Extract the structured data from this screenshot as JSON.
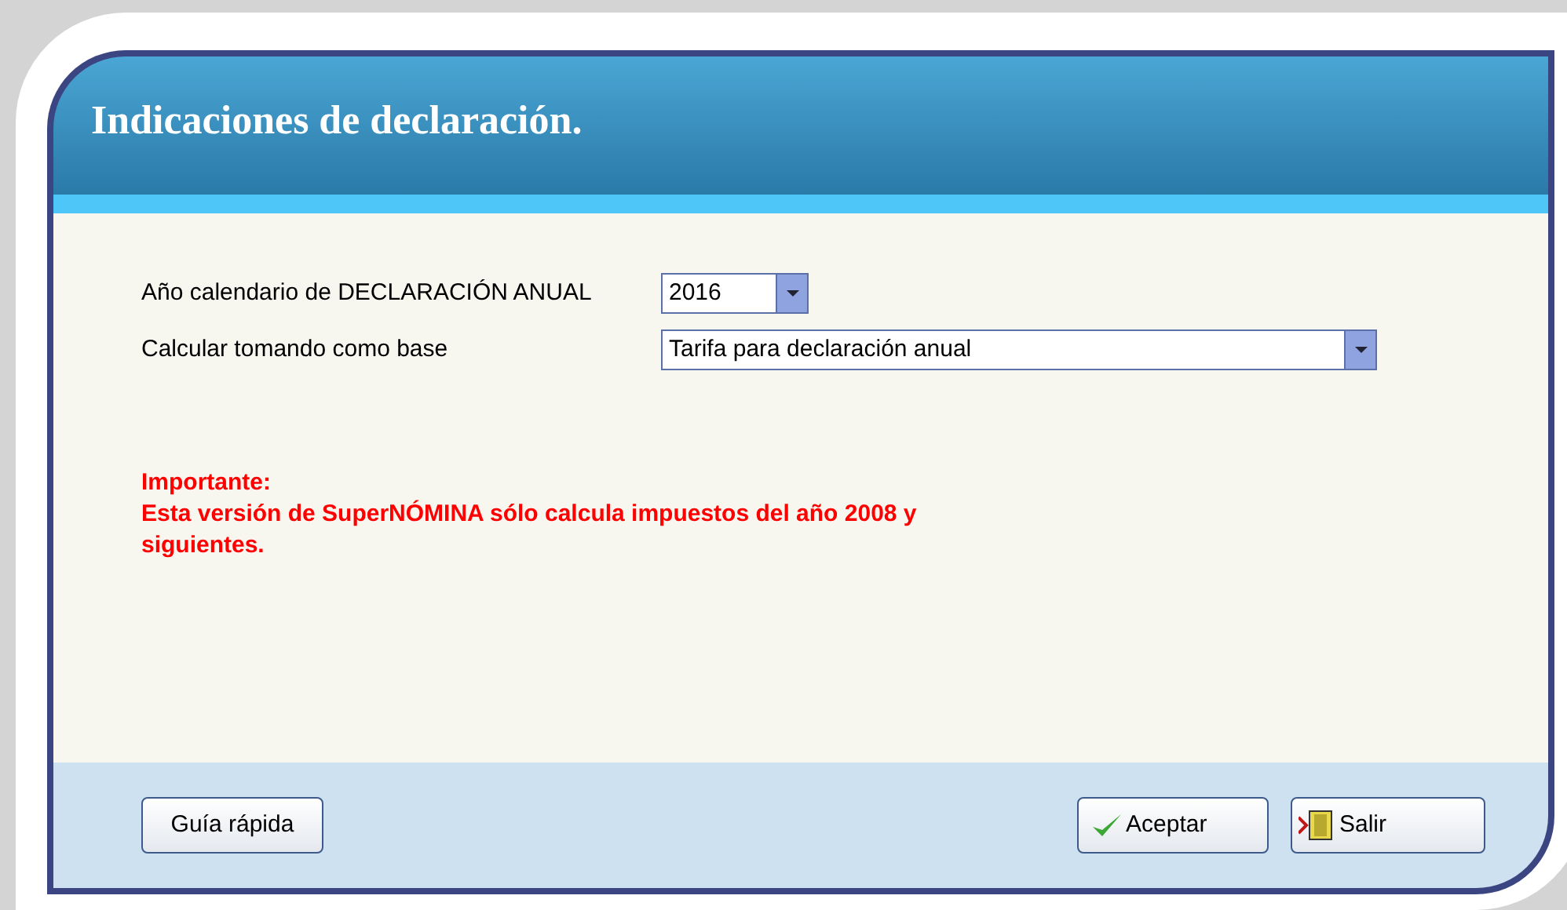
{
  "window": {
    "title": "Indicaciones de declaración."
  },
  "fields": [
    {
      "label": "Año calendario de DECLARACIÓN ANUAL",
      "value": "2016"
    },
    {
      "label": "Calcular tomando como base",
      "value": "Tarifa para declaración anual"
    }
  ],
  "notice": {
    "heading": "Importante:",
    "text": "Esta versión de SuperNÓMINA sólo calcula impuestos del año 2008 y siguientes."
  },
  "buttons": [
    {
      "label": "Guía rápida",
      "kind": "plain"
    },
    {
      "label": "Aceptar",
      "kind": "accept"
    },
    {
      "label": "Salir",
      "kind": "exit"
    }
  ]
}
